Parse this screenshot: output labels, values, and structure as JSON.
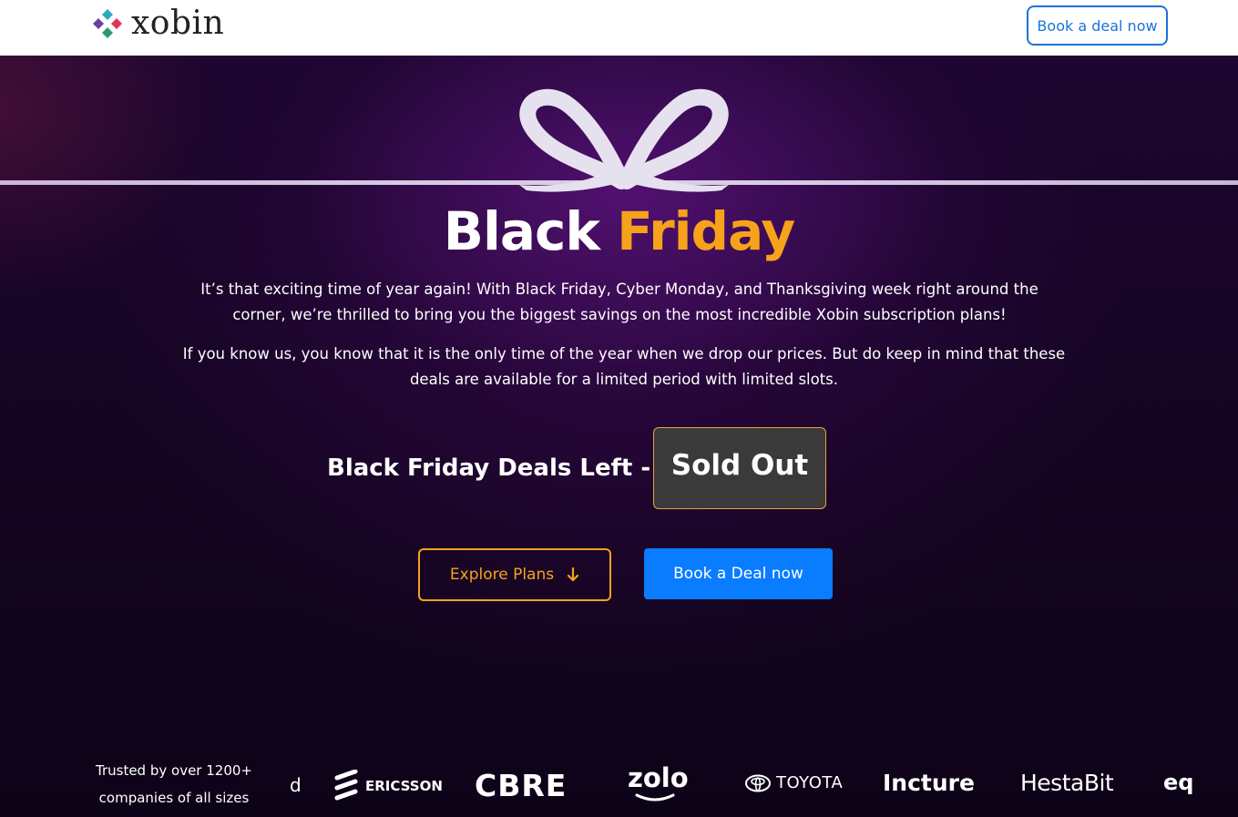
{
  "header": {
    "logo_text": "xobin",
    "cta_label": "Book a deal now"
  },
  "hero": {
    "title_white": "Black",
    "title_orange": "Friday",
    "paragraph1": "It’s that exciting time of year again! With Black Friday, Cyber Monday, and Thanksgiving week right around the corner, we’re thrilled to bring you the biggest savings on the most incredible Xobin subscription plans!",
    "paragraph2": "If you know us, you know that it is the only time of the year when we drop our prices. But do keep in mind that these deals are available for a limited period with limited slots.",
    "deals_label": "Black Friday Deals Left -",
    "deals_status": "Sold Out",
    "explore_label": "Explore Plans",
    "book_label": "Book a Deal now"
  },
  "trusted": {
    "line1": "Trusted by over 1200+",
    "line2": "companies of all sizes"
  },
  "logos": {
    "d": "d",
    "ericsson": "ERICSSON",
    "cbre": "CBRE",
    "zolo": "zolo",
    "toyota": "TOYOTA",
    "incture": "Incture",
    "hestabit": "HestaBit",
    "eq": "eq"
  },
  "colors": {
    "accent_orange": "#f7a21b",
    "primary_blue": "#0a7cff",
    "header_blue": "#1a73d9",
    "background": "#0d0317"
  }
}
